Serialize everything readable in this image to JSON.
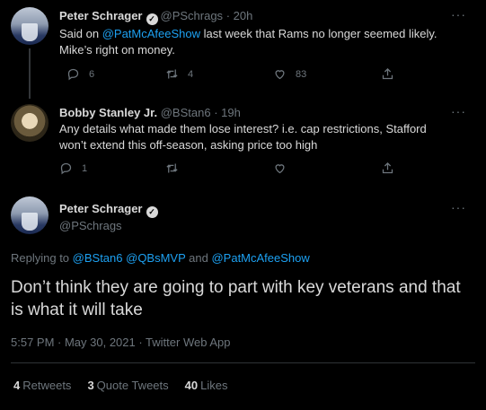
{
  "tweets": [
    {
      "name": "Peter Schrager",
      "handle": "@PSchrags",
      "dot": "·",
      "time": "20h",
      "text_parts": [
        "Said on ",
        "@PatMcAfeeShow",
        " last week that Rams no longer seemed likely. Mike’s right on money."
      ],
      "replies": "6",
      "retweets": "4",
      "likes": "83"
    },
    {
      "name": "Bobby Stanley Jr.",
      "handle": "@BStan6",
      "dot": "·",
      "time": "19h",
      "text": "Any details what made them lose interest? i.e. cap restrictions, Stafford won’t extend this off-season, asking price too high",
      "replies": "1",
      "retweets": "",
      "likes": ""
    }
  ],
  "main": {
    "name": "Peter Schrager",
    "handle": "@PSchrags",
    "replying_prefix": "Replying to ",
    "replying_mentions": [
      "@BStan6",
      "@QBsMVP",
      "@PatMcAfeeShow"
    ],
    "replying_and": " and ",
    "text": "Don’t think they are going to part with key veterans and that is what it will take",
    "timestamp": "5:57 PM · May 30, 2021 · Twitter Web App",
    "stats": [
      {
        "count": "4",
        "label": "Retweets"
      },
      {
        "count": "3",
        "label": "Quote Tweets"
      },
      {
        "count": "40",
        "label": "Likes"
      }
    ]
  },
  "more_glyph": "···",
  "verified_glyph": "✓",
  "icons": [
    "reply-icon",
    "retweet-icon",
    "like-icon",
    "share-icon",
    "verified-icon",
    "more-icon"
  ],
  "colors": {
    "background": "#000000",
    "text": "#d9d9d9",
    "muted": "#6e767d",
    "link": "#1da1f2",
    "divider": "#2f3336"
  }
}
